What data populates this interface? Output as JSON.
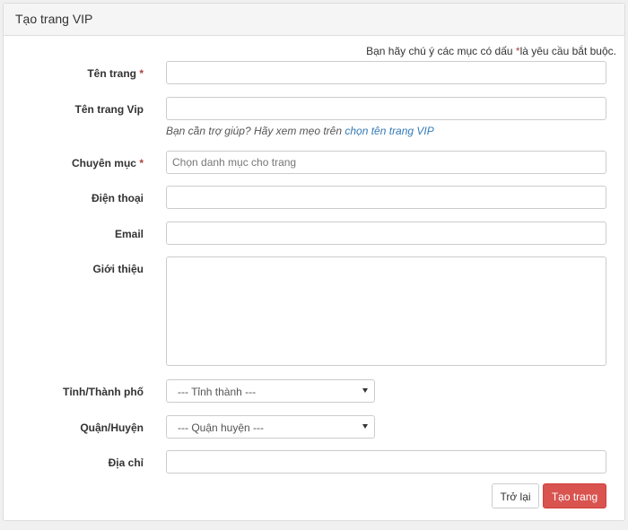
{
  "panel": {
    "title": "Tạo trang VIP"
  },
  "note": {
    "text": "Bạn hãy chú ý các mục có dấu",
    "star": "*",
    "text_after": "là yêu cầu bắt buộc."
  },
  "required_mark": "*",
  "fields": {
    "page_name": {
      "label": "Tên trang",
      "value": "",
      "placeholder": ""
    },
    "vip_name": {
      "label": "Tên trang Vip",
      "value": "",
      "placeholder": ""
    },
    "help": {
      "text": "Bạn cần trợ giúp? Hãy xem mẹo trên",
      "link": "chọn tên trang VIP"
    },
    "category": {
      "label": "Chuyên mục",
      "placeholder": "Chọn danh mục cho trang"
    },
    "phone": {
      "label": "Điện thoại",
      "value": ""
    },
    "email": {
      "label": "Email",
      "value": ""
    },
    "intro": {
      "label": "Giới thiệu",
      "value": ""
    },
    "province": {
      "label": "Tỉnh/Thành phố",
      "selected": "--- Tỉnh thành ---"
    },
    "district": {
      "label": "Quận/Huyện",
      "selected": "--- Quận huyện ---"
    },
    "address": {
      "label": "Địa chỉ",
      "value": ""
    }
  },
  "buttons": {
    "back": "Trở lại",
    "submit": "Tạo trang"
  },
  "colors": {
    "primary_link": "#337ab7",
    "danger": "#d9534f",
    "required": "#a94442"
  }
}
